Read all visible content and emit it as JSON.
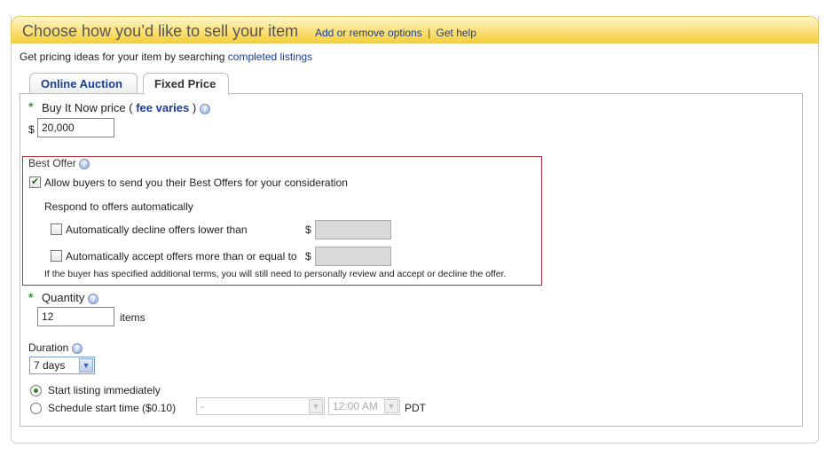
{
  "header": {
    "title": "Choose how you’d like to sell your item",
    "link_options": "Add or remove options",
    "separator": "|",
    "link_help": "Get help"
  },
  "intro": {
    "text": "Get pricing ideas for your item by searching",
    "link": "completed listings"
  },
  "tabs": [
    {
      "label": "Online Auction",
      "active": false
    },
    {
      "label": "Fixed Price",
      "active": true
    }
  ],
  "buy_it_now": {
    "required_mark": "*",
    "label": "Buy It Now price (",
    "fee_link": "fee varies",
    "label_end": ")",
    "currency": "$",
    "value": "20,000"
  },
  "best_offer": {
    "title": "Best Offer",
    "allow_label": "Allow buyers to send you their Best Offers for your consideration",
    "allow_checked": true,
    "respond_label": "Respond to offers automatically",
    "decline_label": "Automatically decline offers lower than",
    "accept_label": "Automatically accept offers more than or equal to",
    "currency": "$",
    "note": "If the buyer has specified additional terms, you will still need to personally review and accept or decline the offer."
  },
  "quantity": {
    "required_mark": "*",
    "label": "Quantity",
    "value": "12",
    "unit": "items"
  },
  "duration": {
    "label": "Duration",
    "selected": "7 days"
  },
  "start": {
    "immediate_label": "Start listing immediately",
    "schedule_label": "Schedule start time ($0.10)",
    "date_placeholder": "-",
    "time_value": "12:00 AM",
    "timezone": "PDT"
  },
  "icons": {
    "help": "help-icon",
    "dropdown": "chevron-down-icon",
    "check": "checkmark-icon"
  },
  "colors": {
    "link": "#1a3d99",
    "required": "#3a9a3a",
    "best_offer_border": "#b8323f",
    "header_gold": "#f5cf3c"
  }
}
